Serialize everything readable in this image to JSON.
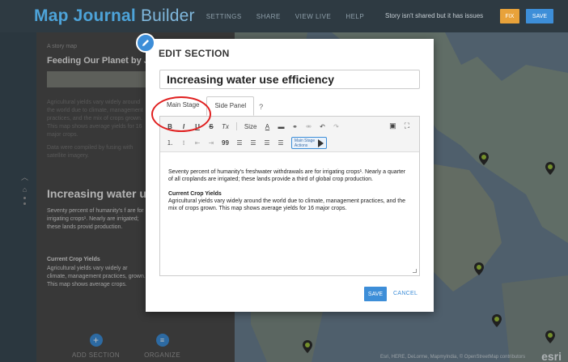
{
  "app": {
    "title": "Map Journal",
    "title_suffix": "Builder",
    "menu": [
      "SETTINGS",
      "SHARE",
      "VIEW LIVE",
      "HELP"
    ],
    "status": "Story isn't shared but it has issues",
    "fix_label": "FIX",
    "save_label": "SAVE"
  },
  "left_panel": {
    "subtitle": "A story map",
    "story_title": "Feeding Our Planet by Ju",
    "faded_text": "Agricultural yields vary widely around the world due to climate, management practices, and the mix of crops grown. This map shows average yields for 16 major crops.",
    "faded_text2": "Data were compiled by fusing with satellite imagery.",
    "section_heading": "Increasing water us",
    "section_body": "Seventy percent of humanity's f are for irrigating crops¹. Nearly are irrigated; these lands provid production.",
    "subhead": "Current Crop Yields",
    "body2": "Agricultural yields vary widely ar climate, management practices, grown. This map shows average crops.",
    "add_section": "ADD SECTION",
    "organize": "ORGANIZE"
  },
  "map": {
    "credit": "Esri, HERE, DeLorme, MapmyIndia, © OpenStreetMap contributors",
    "logo": "esri"
  },
  "dialog": {
    "title": "EDIT SECTION",
    "section_title_value": "Increasing water use efficiency",
    "tabs": [
      "Main Stage",
      "Side Panel"
    ],
    "active_tab": "Side Panel",
    "toolbar": {
      "bold": "B",
      "italic": "I",
      "underline": "U",
      "strike": "S",
      "clear": "Tx",
      "size": "Size",
      "font_color": "A",
      "quote": "99",
      "stage_actions": "Main Stage Actions"
    },
    "body_p1": "Seventy percent of humanity's freshwater withdrawals are for irrigating crops¹. Nearly a quarter of all croplands are irrigated; these lands provide a third of global crop production.",
    "body_subhead": "Current Crop Yields",
    "body_p2": "Agricultural yields vary widely around the world due to climate, management practices, and the mix of crops grown. This map shows average yields for 16 major crops.",
    "save": "SAVE",
    "cancel": "CANCEL"
  },
  "colors": {
    "accent": "#3d8ed8",
    "fix": "#e8a23a",
    "highlight": "#e02020"
  }
}
